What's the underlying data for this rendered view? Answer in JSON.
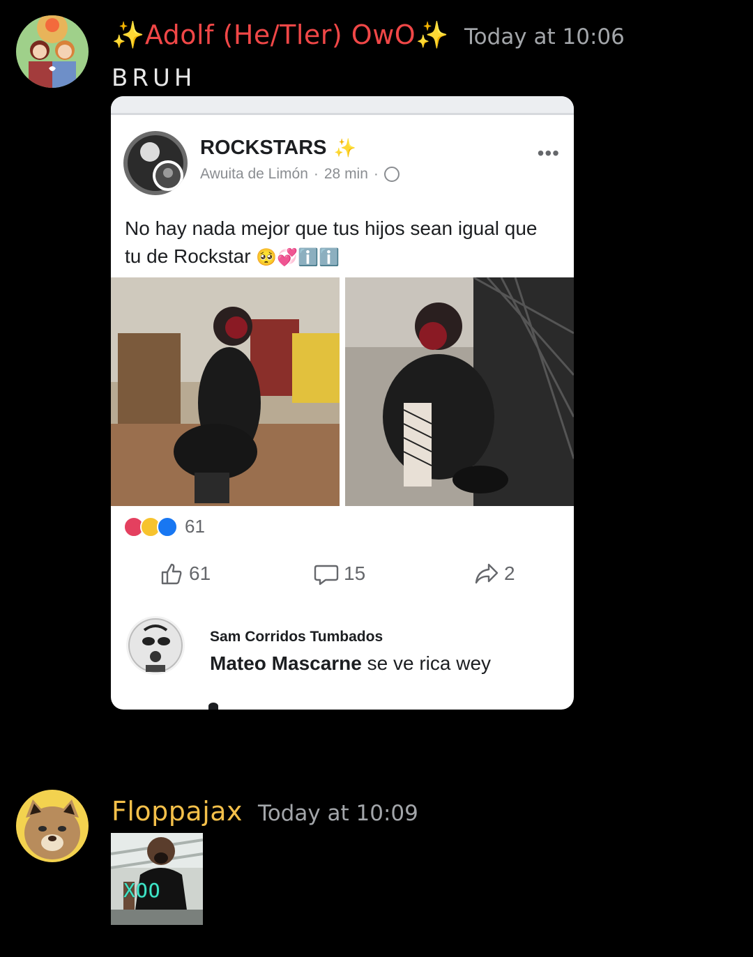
{
  "messages": [
    {
      "author": "✨Adolf (He/Tler) OwO✨",
      "author_color": "#f04747",
      "timestamp": "Today at 10:06",
      "text": "BRUH"
    },
    {
      "author": "Floppajax",
      "author_color": "#f4c04a",
      "timestamp": "Today at 10:09",
      "gif_caption": "XOO"
    }
  ],
  "embed": {
    "group_name": "ROCKSTARS",
    "group_sparkle": "✨",
    "page_name": "Awuita de Limón",
    "time": "28 min",
    "more": "•••",
    "post_text": "No hay nada mejor que tus hijos sean igual que tu de Rockstar",
    "post_emojis": "🥺💞ℹ️ℹ️",
    "reaction_count": "61",
    "actions": {
      "like_count": "61",
      "comment_count": "15",
      "share_count": "2"
    },
    "comment": {
      "author": "Sam Corridos Tumbados",
      "tagged": "Mateo Mascarne",
      "text": " se ve rica wey"
    }
  },
  "colors": {
    "background": "#000000",
    "timestamp": "#a3a6aa",
    "fb_text": "#1c1e21",
    "fb_meta": "#8a8d91"
  },
  "icons": [
    "like-icon",
    "comment-icon",
    "share-icon",
    "globe-icon",
    "more-icon"
  ]
}
